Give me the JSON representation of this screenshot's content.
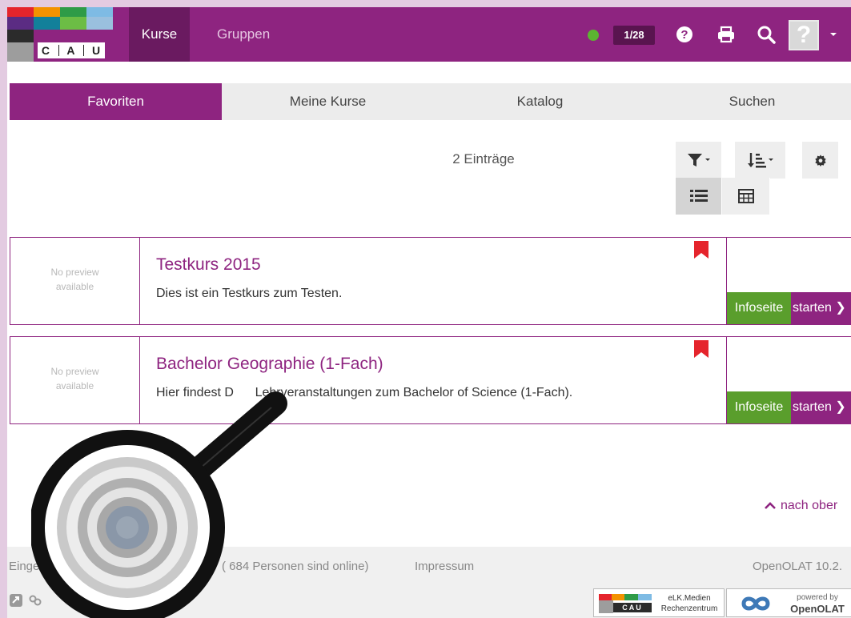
{
  "logo": {
    "letters": [
      "C",
      "A",
      "U"
    ],
    "colors": [
      "#e5242c",
      "#f39200",
      "#2e9b47",
      "#7ebbe4",
      "#5b2c83",
      "#12809a",
      "#6cbd45",
      "#9ac0de",
      "#2b2b2b",
      "#9d9d9d"
    ]
  },
  "nav": {
    "items": [
      {
        "label": "Kurse",
        "active": true
      },
      {
        "label": "Gruppen",
        "active": false
      }
    ],
    "counter": "1/28",
    "icons": [
      "help-icon",
      "print-icon",
      "search-icon"
    ],
    "avatar_glyph": "?"
  },
  "tabs": [
    {
      "label": "Favoriten",
      "active": true
    },
    {
      "label": "Meine Kurse",
      "active": false
    },
    {
      "label": "Katalog",
      "active": false
    },
    {
      "label": "Suchen",
      "active": false
    }
  ],
  "toolbar": {
    "entries": "2 Einträge",
    "icons": [
      "filter-icon",
      "sort-icon",
      "gear-icon",
      "list-view-icon",
      "table-view-icon"
    ]
  },
  "courses": [
    {
      "preview": "No preview\navailable",
      "title": "Testkurs 2015",
      "description": "Dies ist ein Testkurs zum Testen.",
      "info": "Infoseite",
      "start": "starten ❯"
    },
    {
      "preview": "No preview\navailable",
      "title": "Bachelor Geographie (1-Fach)",
      "description": "Hier findest D      Lehrveranstaltungen zum Bachelor of Science (1-Fach).",
      "info": "Infoseite",
      "start": "starten ❯"
    }
  ],
  "to_top": "nach ober",
  "footer": {
    "logged_in": "Einge",
    "online": "( 684 Personen sind online)",
    "impressum": "Impressum",
    "version": "OpenOLAT 10.2.",
    "badge_cau_line1": "eLK.Medien",
    "badge_cau_line2": "Rechenzentrum",
    "badge_openolat_line1": "powered by",
    "badge_openolat_line2": "OpenOLAT"
  },
  "colors": {
    "brand": "#8e2480",
    "brand_dark": "#6a1a60",
    "success": "#5a9e2c",
    "status_online": "#5cb531",
    "bookmark": "#e5242c"
  }
}
